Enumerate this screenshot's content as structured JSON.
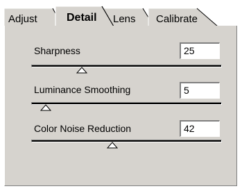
{
  "tabs": [
    {
      "label": "Adjust",
      "active": false
    },
    {
      "label": "Detail",
      "active": true
    },
    {
      "label": "Lens",
      "active": false
    },
    {
      "label": "Calibrate",
      "active": false
    }
  ],
  "sliders": [
    {
      "label": "Sharpness",
      "value": "25",
      "level": 0.25
    },
    {
      "label": "Luminance Smoothing",
      "value": "5",
      "level": 0.05
    },
    {
      "label": "Color Noise Reduction",
      "value": "42",
      "level": 0.42
    }
  ],
  "colors": {
    "panel": "#d6d3ce",
    "highlight": "#ffffff",
    "shadow": "#808080"
  }
}
